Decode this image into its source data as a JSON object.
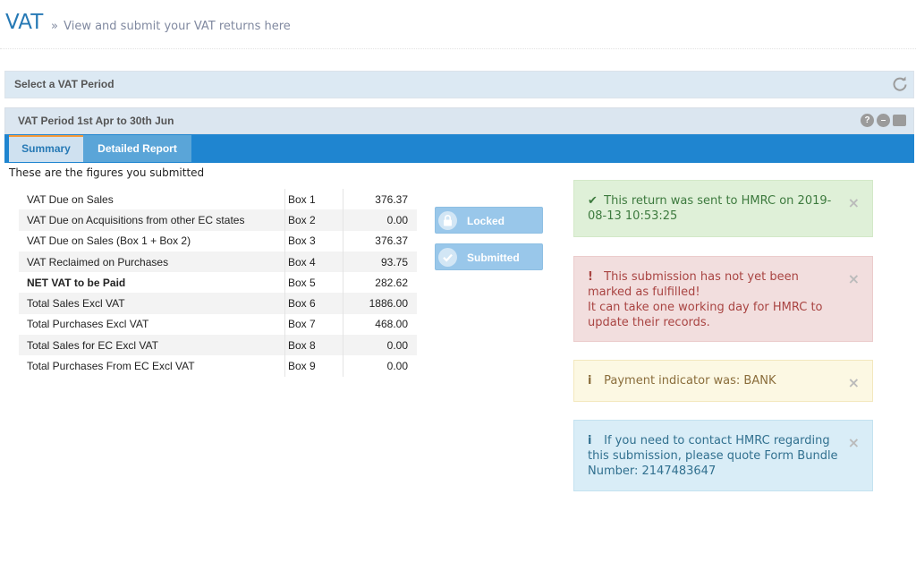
{
  "header": {
    "title": "VAT",
    "subtitle_prefix": "»",
    "subtitle": "View and submit your VAT returns here"
  },
  "period_select": {
    "title": "Select a VAT Period",
    "refresh_icon": "refresh-icon"
  },
  "period": {
    "title": "VAT Period 1st Apr to 30th Jun",
    "help_glyph": "?",
    "collapse_glyph": "–",
    "tabs": [
      {
        "label": "Summary",
        "active": true
      },
      {
        "label": "Detailed Report",
        "active": false
      }
    ]
  },
  "summary": {
    "intro": "These are the figures you submitted",
    "rows": [
      {
        "desc": "VAT Due on Sales",
        "box": "Box 1",
        "value": "376.37",
        "bold": false
      },
      {
        "desc": "VAT Due on Acquisitions from other EC states",
        "box": "Box 2",
        "value": "0.00",
        "bold": false
      },
      {
        "desc": "VAT Due on Sales (Box 1 + Box 2)",
        "box": "Box 3",
        "value": "376.37",
        "bold": false
      },
      {
        "desc": "VAT Reclaimed on Purchases",
        "box": "Box 4",
        "value": "93.75",
        "bold": false
      },
      {
        "desc": "NET VAT to be Paid",
        "box": "Box 5",
        "value": "282.62",
        "bold": true
      },
      {
        "desc": "Total Sales Excl VAT",
        "box": "Box 6",
        "value": "1886.00",
        "bold": false
      },
      {
        "desc": "Total Purchases Excl VAT",
        "box": "Box 7",
        "value": "468.00",
        "bold": false
      },
      {
        "desc": "Total Sales for EC Excl VAT",
        "box": "Box 8",
        "value": "0.00",
        "bold": false
      },
      {
        "desc": "Total Purchases From EC Excl VAT",
        "box": "Box 9",
        "value": "0.00",
        "bold": false
      }
    ]
  },
  "buttons": {
    "locked": {
      "label": "Locked",
      "icon": "lock-icon"
    },
    "submitted": {
      "label": "Submitted",
      "icon": "check-circle-icon"
    }
  },
  "alerts": {
    "success": {
      "icon": "✔",
      "text": "This return was sent to HMRC on 2019-08-13 10:53:25",
      "close": "×"
    },
    "danger": {
      "icon": "!",
      "line1": "This submission has not yet been marked as fulfilled!",
      "line2": "It can take one working day for HMRC to update their records.",
      "close": "×"
    },
    "warning": {
      "icon": "i",
      "text": "Payment indicator was: BANK",
      "close": "×"
    },
    "info": {
      "icon": "i",
      "text": "If you need to contact HMRC regarding this submission, please quote Form Bundle Number: 2147483647",
      "close": "×"
    }
  },
  "colors": {
    "brand_blue": "#2679b5",
    "tab_bar": "#1f85d0",
    "success_bg": "#dff0d8",
    "danger_bg": "#f2dede",
    "warning_bg": "#fcf8e3",
    "info_bg": "#d9edf7"
  }
}
